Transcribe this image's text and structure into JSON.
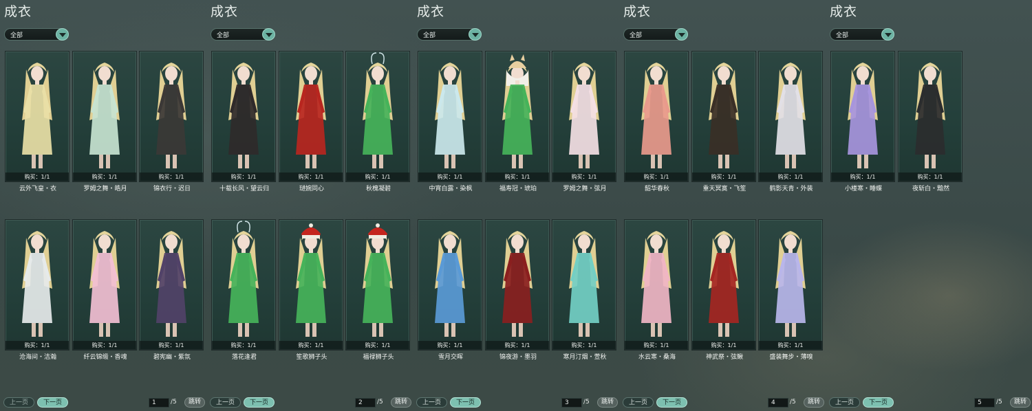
{
  "panels": [
    {
      "title": "成衣",
      "filter": "全部",
      "prev": "上一页",
      "next": "下一页",
      "page": "1",
      "total": "/5",
      "jump": "跳转",
      "items": [
        {
          "buy": "购买：1/1",
          "name": "云外飞皇・衣",
          "outfit": "#e9dfa6",
          "hat": "none"
        },
        {
          "buy": "购买：1/1",
          "name": "罗姆之舞・皓月",
          "outfit": "#c7e3d0",
          "hat": "none"
        },
        {
          "buy": "购买：1/1",
          "name": "锦衣行・迟日",
          "outfit": "#3b3836",
          "hat": "none"
        },
        {
          "buy": "购买：1/1",
          "name": "沧海间・洁瀚",
          "outfit": "#e6eaea",
          "hat": "none"
        },
        {
          "buy": "购买：1/1",
          "name": "纤云锦缎・香魂",
          "outfit": "#f2bfd2",
          "hat": "none"
        },
        {
          "buy": "购买：1/1",
          "name": "碧宪幽・紫氛",
          "outfit": "#514268",
          "hat": "none"
        }
      ]
    },
    {
      "title": "成衣",
      "filter": "全部",
      "prev": "上一页",
      "next": "下一页",
      "page": "2",
      "total": "/5",
      "jump": "跳转",
      "items": [
        {
          "buy": "购买：1/1",
          "name": "十载长风・望云归",
          "outfit": "#2f2a2a",
          "hat": "none"
        },
        {
          "buy": "购买：1/1",
          "name": "琎婉同心",
          "outfit": "#b8261f",
          "hat": "none"
        },
        {
          "buy": "购买：1/1",
          "name": "秋槐凝碧",
          "outfit": "#46b35a",
          "hat": "ribbon"
        },
        {
          "buy": "购买：1/1",
          "name": "落花逢君",
          "outfit": "#46b35a",
          "hat": "ribbon"
        },
        {
          "buy": "购买：1/1",
          "name": "笙歌狮子头",
          "outfit": "#46b35a",
          "hat": "lion"
        },
        {
          "buy": "购买：1/1",
          "name": "福禄狮子头",
          "outfit": "#46b35a",
          "hat": "lion"
        }
      ]
    },
    {
      "title": "成衣",
      "filter": "全部",
      "prev": "上一页",
      "next": "下一页",
      "page": "3",
      "total": "/5",
      "jump": "跳转",
      "items": [
        {
          "buy": "购买：1/1",
          "name": "中宵白露・染枫",
          "outfit": "#cbe8ec",
          "hat": "none"
        },
        {
          "buy": "购买：1/1",
          "name": "福寿冠・琥珀",
          "outfit": "#46b35a",
          "hat": "dog"
        },
        {
          "buy": "购买：1/1",
          "name": "罗姆之舞・弦月",
          "outfit": "#f4dfe4",
          "hat": "none"
        },
        {
          "buy": "购买：1/1",
          "name": "雪月交晖",
          "outfit": "#5a9ad6",
          "hat": "none"
        },
        {
          "buy": "购买：1/1",
          "name": "锦夜游・墨羽",
          "outfit": "#8a1f1f",
          "hat": "none"
        },
        {
          "buy": "购买：1/1",
          "name": "寒月汀烟・萱秋",
          "outfit": "#73cfc4",
          "hat": "none"
        }
      ]
    },
    {
      "title": "成衣",
      "filter": "全部",
      "prev": "上一页",
      "next": "下一页",
      "page": "4",
      "total": "/5",
      "jump": "跳转",
      "items": [
        {
          "buy": "购买：1/1",
          "name": "韶华春秋",
          "outfit": "#e99a8c",
          "hat": "none"
        },
        {
          "buy": "购买：1/1",
          "name": "重天冥寞・飞笙",
          "outfit": "#3a2f26",
          "hat": "none"
        },
        {
          "buy": "购买：1/1",
          "name": "鹤影天青・外装",
          "outfit": "#e2e0e6",
          "hat": "none"
        },
        {
          "buy": "购买：1/1",
          "name": "水云寒・桑海",
          "outfit": "#f0b5c4",
          "hat": "none"
        },
        {
          "buy": "购买：1/1",
          "name": "神武祭・弦鳅",
          "outfit": "#a52622",
          "hat": "none"
        },
        {
          "buy": "购买：1/1",
          "name": "盛装舞步・薄嗅",
          "outfit": "#b9b6ea",
          "hat": "none"
        }
      ]
    },
    {
      "title": "成衣",
      "filter": "全部",
      "prev": "上一页",
      "next": "下一页",
      "page": "5",
      "total": "/5",
      "jump": "跳转",
      "items": [
        {
          "buy": "购买：1/1",
          "name": "小楼寒・睡蝶",
          "outfit": "#a795dd",
          "hat": "none"
        },
        {
          "buy": "购买：1/1",
          "name": "夜斩白・黯然",
          "outfit": "#2b2d2e",
          "hat": "none"
        }
      ]
    }
  ]
}
